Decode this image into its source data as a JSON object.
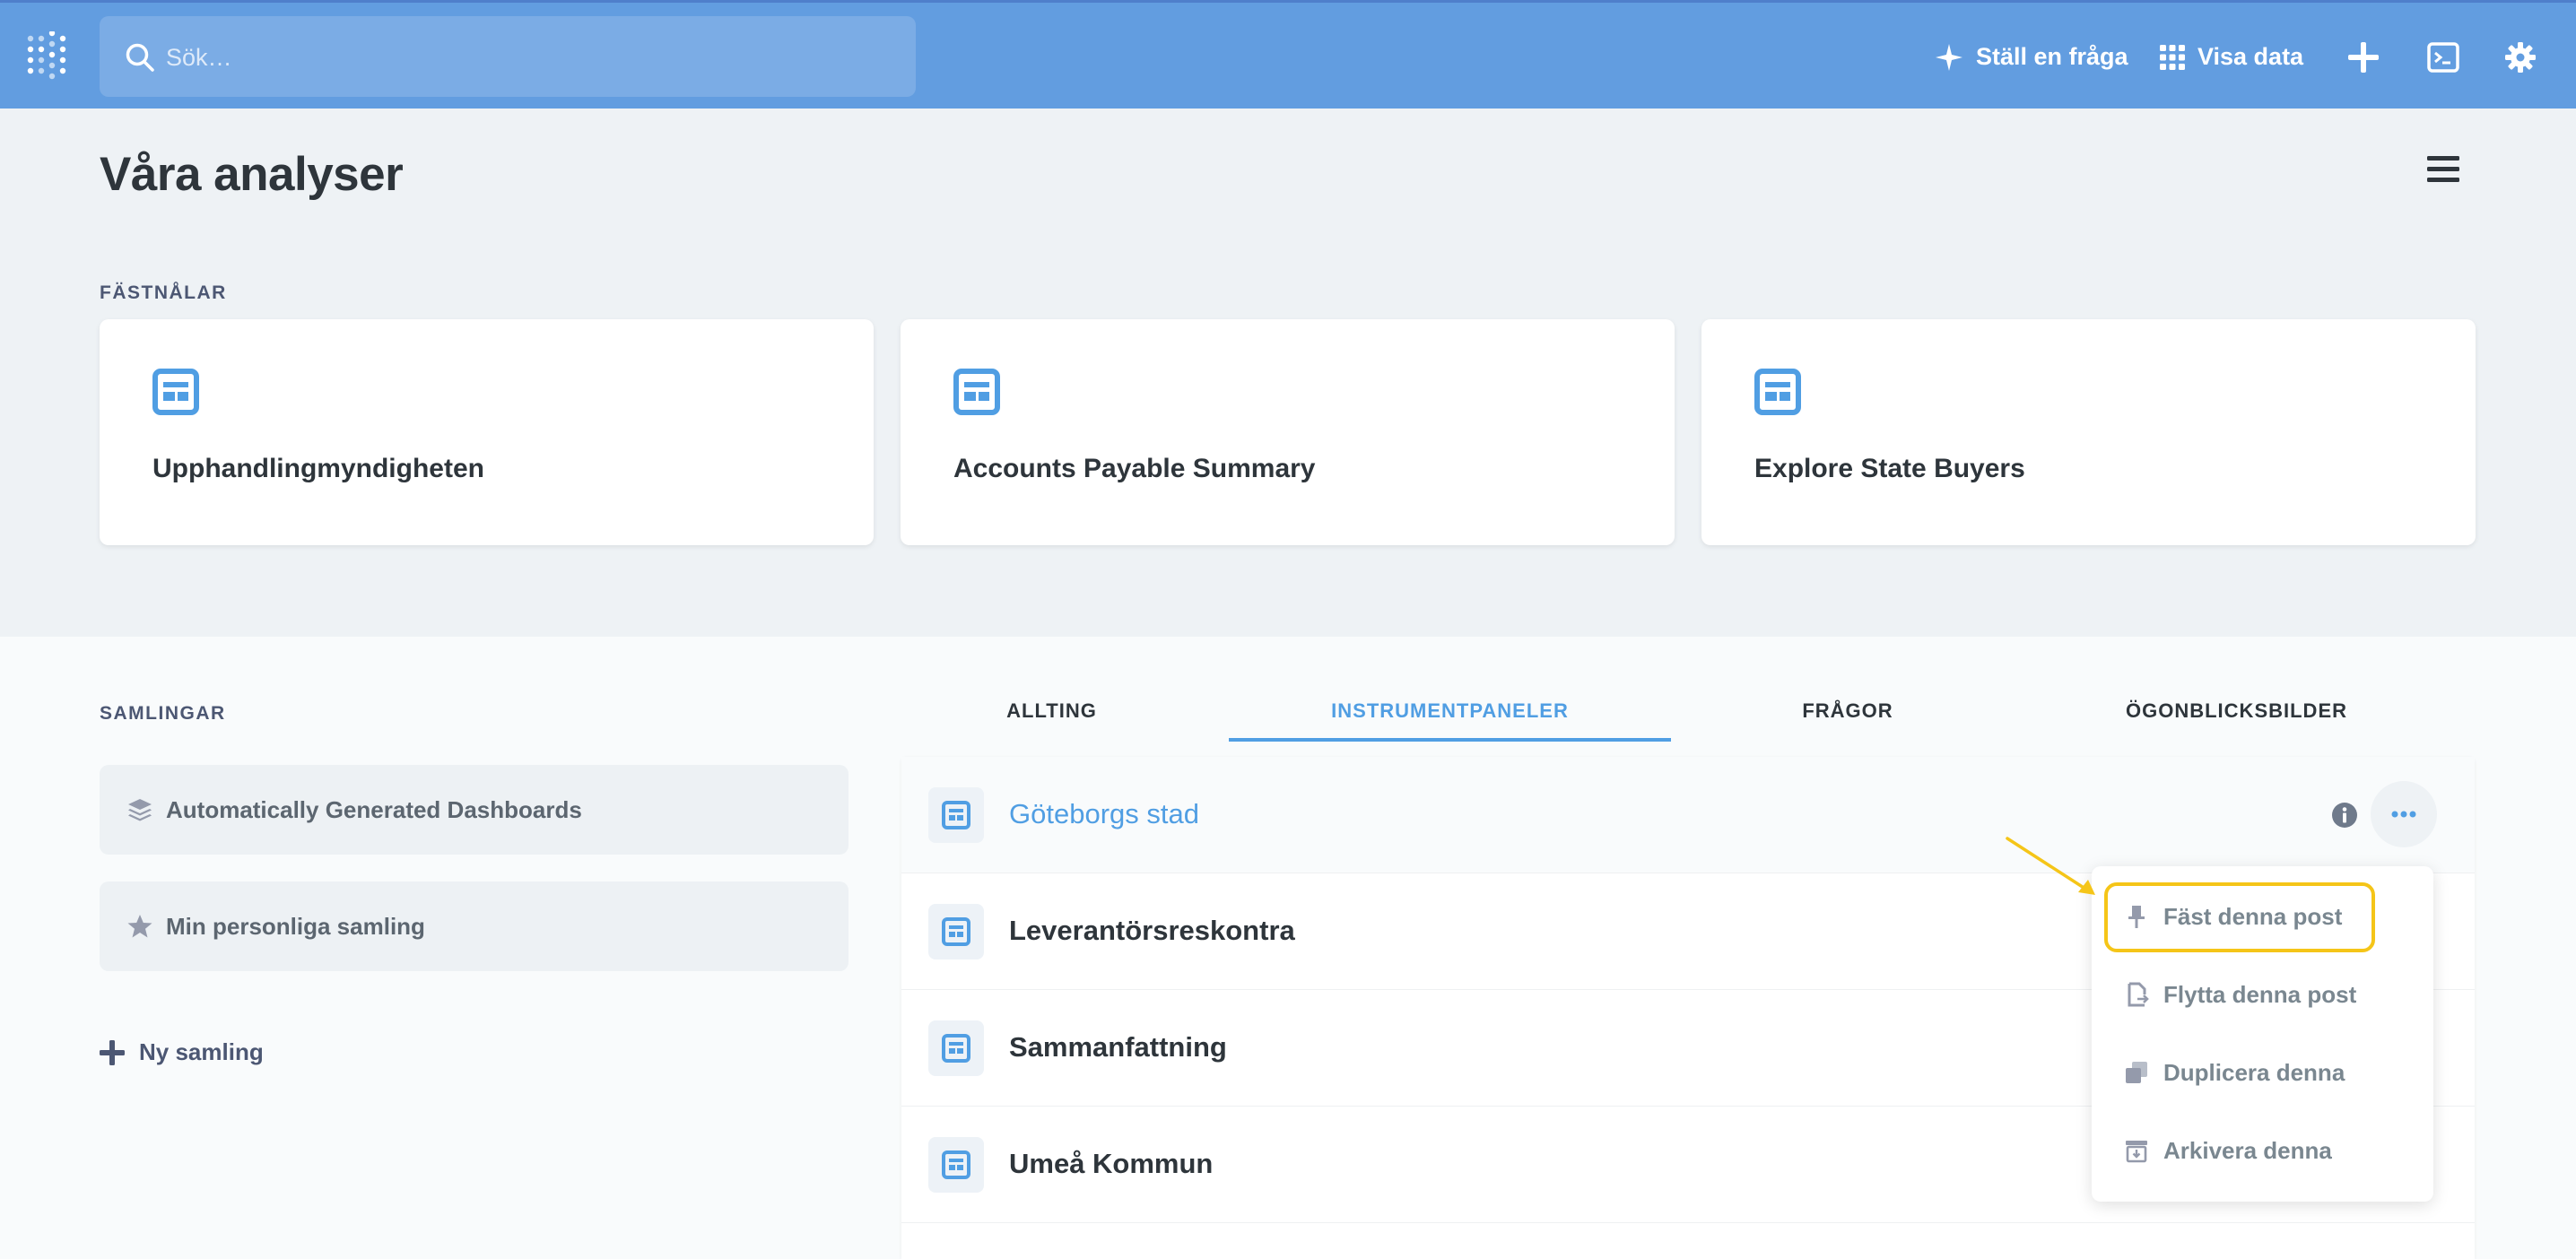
{
  "topnav": {
    "search_placeholder": "Sök…",
    "ask_label": "Ställ en fråga",
    "browse_label": "Visa data",
    "colors": {
      "nav_bg": "#629de0",
      "accent": "#509ee3",
      "highlight": "#f5c518"
    }
  },
  "header": {
    "title": "Våra analyser",
    "pins_label": "FÄSTNÅLAR",
    "pinned": [
      {
        "title": "Upphandlingmyndigheten",
        "icon": "dashboard-icon"
      },
      {
        "title": "Accounts Payable Summary",
        "icon": "dashboard-icon"
      },
      {
        "title": "Explore State Buyers",
        "icon": "dashboard-icon"
      }
    ]
  },
  "collections": {
    "label": "SAMLINGAR",
    "items": [
      {
        "label": "Automatically Generated Dashboards",
        "icon": "layers-icon"
      },
      {
        "label": "Min personliga samling",
        "icon": "star-icon"
      }
    ],
    "new_label": "Ny samling"
  },
  "tabs": [
    {
      "label": "ALLTING",
      "active": false
    },
    {
      "label": "INSTRUMENTPANELER",
      "active": true
    },
    {
      "label": "FRÅGOR",
      "active": false
    },
    {
      "label": "ÖGONBLICKSBILDER",
      "active": false
    }
  ],
  "items": [
    {
      "title": "Göteborgs stad",
      "hovered": true
    },
    {
      "title": "Leverantörsreskontra"
    },
    {
      "title": "Sammanfattning"
    },
    {
      "title": "Umeå Kommun"
    }
  ],
  "menu": {
    "items": [
      {
        "label": "Fäst denna post",
        "icon": "pin-icon"
      },
      {
        "label": "Flytta denna post",
        "icon": "move-icon"
      },
      {
        "label": "Duplicera denna",
        "icon": "duplicate-icon"
      },
      {
        "label": "Arkivera denna",
        "icon": "archive-icon"
      }
    ]
  }
}
